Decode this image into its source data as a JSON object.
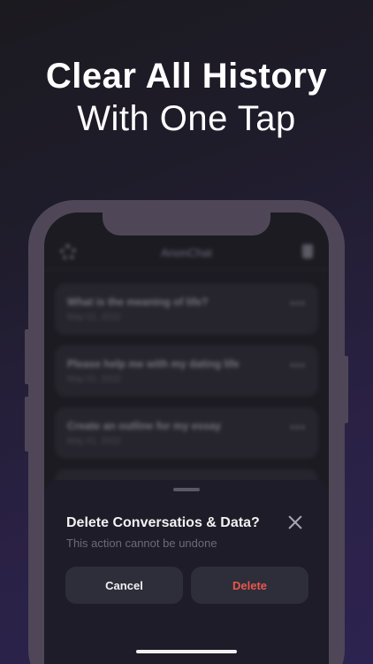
{
  "headline": {
    "line1": "Clear All History",
    "line2": "With One Tap"
  },
  "app": {
    "title": "AnonChat",
    "settings_icon": "gear-icon",
    "trash_icon": "trash-icon",
    "conversations": [
      {
        "title": "What is the meaning of life?",
        "date": "May 01, 2022"
      },
      {
        "title": "Please help me with my dating life",
        "date": "May 01, 2022"
      },
      {
        "title": "Create an outline for my essay",
        "date": "May 01, 2022"
      }
    ],
    "more_icon": "more-dots-icon"
  },
  "sheet": {
    "title": "Delete Conversatios & Data?",
    "subtitle": "This action cannot be undone",
    "cancel_label": "Cancel",
    "delete_label": "Delete",
    "close_icon": "close-icon"
  },
  "colors": {
    "background_accent": "#2d2350",
    "sheet_bg": "#1d1c28",
    "button_bg": "#2e2d3a",
    "delete_text": "#e8584c"
  }
}
